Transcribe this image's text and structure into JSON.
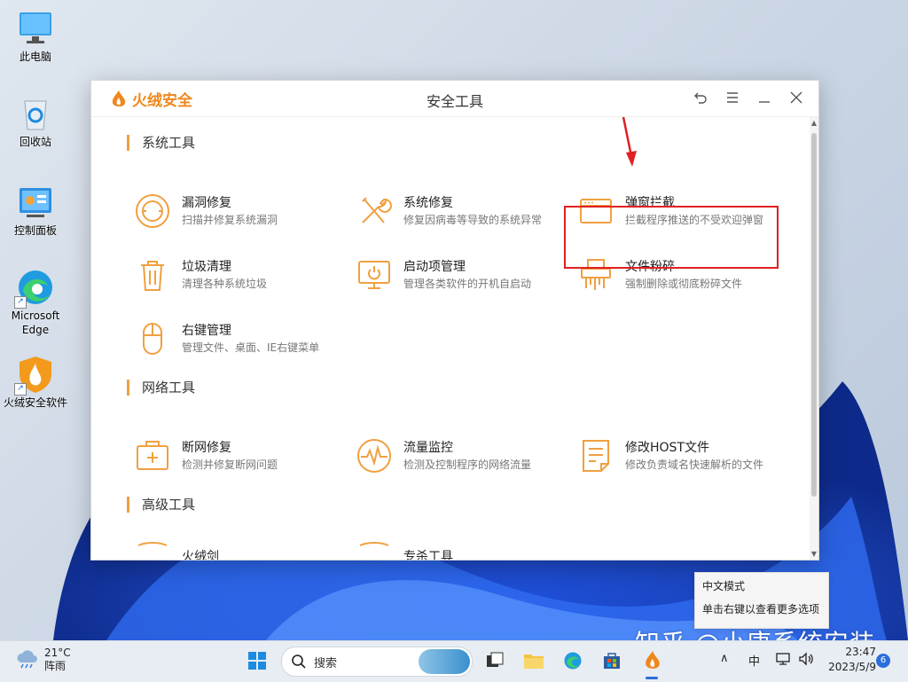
{
  "colors": {
    "accent": "#f0871c",
    "highlight": "#e02020",
    "icon_orange": "#f0a040"
  },
  "desktop": {
    "icons": [
      {
        "label": "此电脑",
        "icon": "monitor-icon"
      },
      {
        "label": "回收站",
        "icon": "recycle-bin-icon"
      },
      {
        "label": "控制面板",
        "icon": "control-panel-icon"
      },
      {
        "label": "Microsoft Edge",
        "icon": "edge-icon"
      },
      {
        "label": "火绒安全软件",
        "icon": "huorong-icon"
      }
    ]
  },
  "window": {
    "brand": "火绒安全",
    "title": "安全工具",
    "controls": [
      "back-icon",
      "menu-icon",
      "minimize-icon",
      "close-icon"
    ]
  },
  "sections": [
    {
      "title": "系统工具",
      "tools": [
        {
          "name": "漏洞修复",
          "desc": "扫描并修复系统漏洞",
          "icon": "bug-fix-icon"
        },
        {
          "name": "系统修复",
          "desc": "修复因病毒等导致的系统异常",
          "icon": "wrench-icon"
        },
        {
          "name": "弹窗拦截",
          "desc": "拦截程序推送的不受欢迎弹窗",
          "icon": "popup-block-icon"
        },
        {
          "name": "垃圾清理",
          "desc": "清理各种系统垃圾",
          "icon": "trash-icon"
        },
        {
          "name": "启动项管理",
          "desc": "管理各类软件的开机自启动",
          "icon": "startup-icon"
        },
        {
          "name": "文件粉碎",
          "desc": "强制删除或彻底粉碎文件",
          "icon": "shredder-icon"
        },
        {
          "name": "右键管理",
          "desc": "管理文件、桌面、IE右键菜单",
          "icon": "mouse-icon"
        }
      ]
    },
    {
      "title": "网络工具",
      "tools": [
        {
          "name": "断网修复",
          "desc": "检测并修复断网问题",
          "icon": "network-repair-icon"
        },
        {
          "name": "流量监控",
          "desc": "检测及控制程序的网络流量",
          "icon": "traffic-monitor-icon"
        },
        {
          "name": "修改HOST文件",
          "desc": "修改负责域名快速解析的文件",
          "icon": "host-file-icon"
        }
      ]
    },
    {
      "title": "高级工具",
      "tools": [
        {
          "name": "火绒剑",
          "desc": "",
          "icon": "sword-icon"
        },
        {
          "name": "专杀工具",
          "desc": "",
          "icon": "shield-icon"
        }
      ]
    }
  ],
  "ime_tooltip": {
    "line1": "中文模式",
    "line2": "单击右键以查看更多选项"
  },
  "watermark": "知乎 @小唐系统安装",
  "taskbar": {
    "weather_temp": "21°C",
    "weather_desc": "阵雨",
    "search_placeholder": "搜索",
    "ime_label": "中",
    "time": "23:47",
    "date": "2023/5/9",
    "notification_count": "6"
  }
}
